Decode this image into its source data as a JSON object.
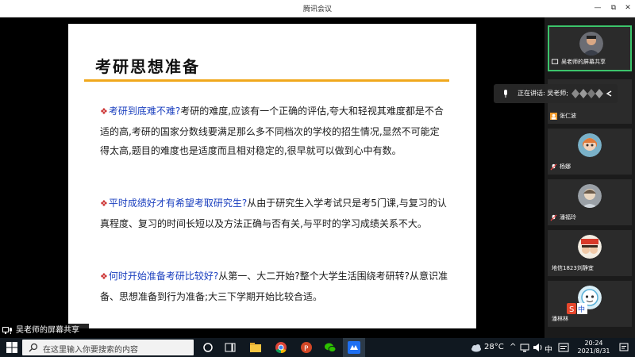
{
  "window": {
    "title": "腾讯会议",
    "minimize_glyph": "—",
    "restore_glyph": "⧉",
    "close_glyph": "✕"
  },
  "slide": {
    "title": "考研思想准备",
    "bullet_glyph": "❖",
    "paragraphs": [
      {
        "question": "考研到底难不难?",
        "answer": "考研的难度,应该有一个正确的评估,夸大和轻视其难度都是不合适的高,考研的国家分数线要满足那么多不同档次的学校的招生情况,显然不可能定得太高,题目的难度也是适度而且相对稳定的,很早就可以做到心中有数。"
      },
      {
        "question": "平时成绩好才有希望考取研究生?",
        "answer": "从由于研究生入学考试只是考5门课,与复习的认真程度、复习的时间长短以及方法正确与否有关,与平时的学习成绩关系不大。"
      },
      {
        "question": "何时开始准备考研比较好?",
        "answer": "从第一、大二开始?整个大学生活围绕考研转?从意识准备、思想准备到行为准备;大三下学期开始比较合适。"
      }
    ]
  },
  "share_bar": {
    "label": "吴老师的屏幕共享"
  },
  "speaking": {
    "text": "正在讲话: 吴老师;"
  },
  "participants": [
    {
      "name": "吴老师的屏幕共享",
      "active": true
    },
    {
      "name": "张仁波",
      "active": false
    },
    {
      "name": "杨娜",
      "active": false
    },
    {
      "name": "潘福玲",
      "active": false
    },
    {
      "name": "地信1823刘静宜",
      "active": false
    },
    {
      "name": "潘林林",
      "active": false
    }
  ],
  "taskbar": {
    "search_placeholder": "在这里输入你要搜索的内容",
    "temperature": "28°C",
    "ime": "中",
    "time": "20:24",
    "date": "2021/8/31"
  }
}
